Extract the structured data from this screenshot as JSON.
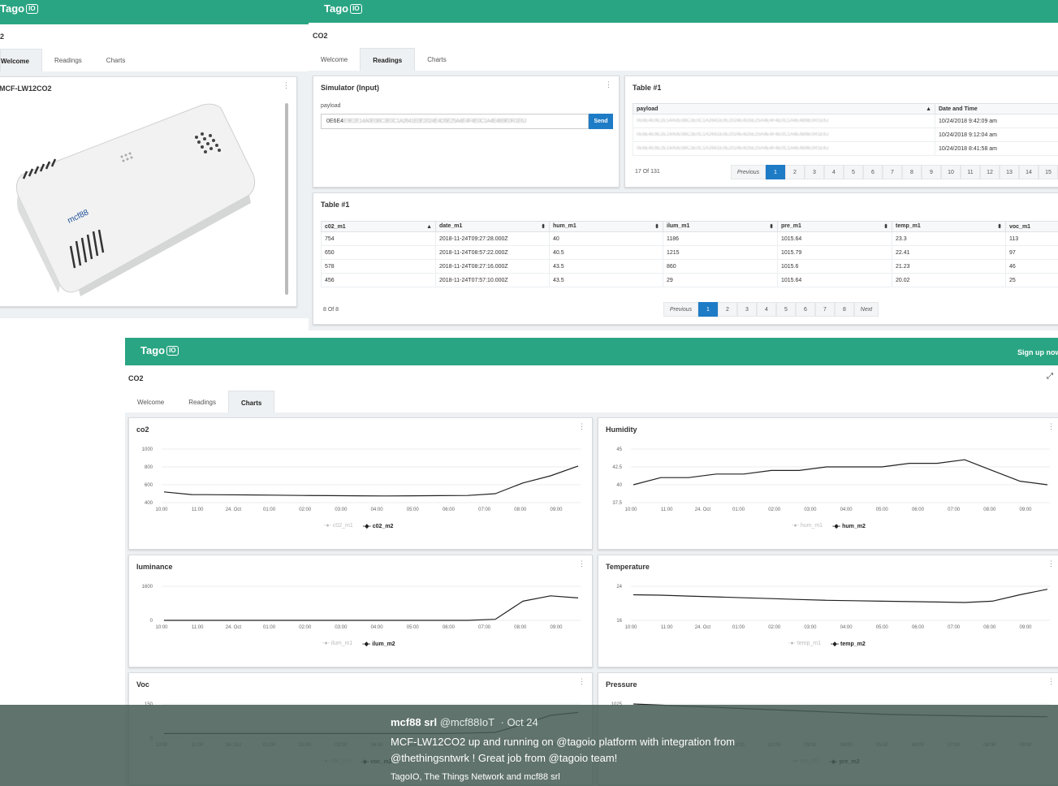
{
  "brand": {
    "name": "Tago",
    "suffix": "IO"
  },
  "dash1": {
    "title": "2",
    "tabs": [
      "Welcome",
      "Readings",
      "Charts"
    ],
    "device_title": "MCF-LW12CO2"
  },
  "dash2": {
    "title": "CO2",
    "tabs": [
      "Welcome",
      "Readings",
      "Charts"
    ],
    "simulator": {
      "title": "Simulator (Input)",
      "label": "payload",
      "value": "0E6E4",
      "send": "Send"
    },
    "table1": {
      "title": "Table #1",
      "headers": [
        "payload",
        "Date and Time"
      ],
      "rows": [
        [
          "0E6E4E9E2E14A0E0BC3E0C1A2641E0E2024E4D5E25A4E4F4E0C1A4E4B9E0R1E6J",
          "10/24/2018 9:42:09 am"
        ],
        [
          "0E6E4E9E2E14A0E0BC3E0C1A2641E0E2024E4D5E25A4E4F4E0C1A4E4B9E0R1E6J",
          "10/24/2018 9:12:04 am"
        ],
        [
          "0E6E4E9E2E14A0E0BC3E0C1A2641E0E2024E4D5E25A4E4F4E0C1A4E4B9E0R1E6J",
          "10/24/2018 8:41:58 am"
        ]
      ],
      "count": "17 Of 131",
      "prev": "Previous",
      "pages": [
        "1",
        "2",
        "3",
        "4",
        "5",
        "6",
        "7",
        "8",
        "9",
        "10",
        "11",
        "12",
        "13",
        "14",
        "15"
      ]
    },
    "table2": {
      "title": "Table #1",
      "headers": [
        "c02_m1",
        "date_m1",
        "hum_m1",
        "ilum_m1",
        "pre_m1",
        "temp_m1",
        "voc_m1"
      ],
      "rows": [
        [
          "754",
          "2018-11-24T09:27:28.000Z",
          "40",
          "1186",
          "1015.64",
          "23.3",
          "113"
        ],
        [
          "650",
          "2018-11-24T08:57:22.000Z",
          "40.5",
          "1215",
          "1015.79",
          "22.41",
          "97"
        ],
        [
          "578",
          "2018-11-24T08:27:16.000Z",
          "43.5",
          "860",
          "1015.6",
          "21.23",
          "46"
        ],
        [
          "456",
          "2018-11-24T07:57:10.000Z",
          "43.5",
          "29",
          "1015.64",
          "20.02",
          "25"
        ]
      ],
      "count": "8 Of 8",
      "prev": "Previous",
      "next": "Next",
      "pages": [
        "1",
        "2",
        "3",
        "4",
        "5",
        "6",
        "7",
        "8"
      ]
    }
  },
  "dash3": {
    "title": "CO2",
    "signup": "Sign up now",
    "tabs": [
      "Welcome",
      "Readings",
      "Charts"
    ],
    "x_ticks": [
      "10:00",
      "11:00",
      "24. Oct",
      "01:00",
      "02:00",
      "03:00",
      "04:00",
      "05:00",
      "06:00",
      "07:00",
      "08:00",
      "09:00"
    ]
  },
  "chart_data": [
    {
      "type": "line",
      "title": "co2",
      "ylim": [
        400,
        1000
      ],
      "yticks": [
        "1000",
        "800",
        "600",
        "400"
      ],
      "series": [
        {
          "name": "c02_m1",
          "values": []
        },
        {
          "name": "c02_m2",
          "values": [
            520,
            490,
            488,
            486,
            484,
            480,
            478,
            476,
            475,
            476,
            478,
            480,
            500,
            620,
            700,
            810
          ]
        }
      ]
    },
    {
      "type": "line",
      "title": "Humidity",
      "ylim": [
        37.5,
        45
      ],
      "yticks": [
        "45",
        "42.5",
        "40",
        "37.5"
      ],
      "series": [
        {
          "name": "hum_m1",
          "values": []
        },
        {
          "name": "hum_m2",
          "values": [
            40.0,
            41.0,
            41.0,
            41.5,
            41.5,
            42.0,
            42.0,
            42.5,
            42.5,
            42.5,
            43.0,
            43.0,
            43.5,
            42.0,
            40.5,
            40.0
          ]
        }
      ]
    },
    {
      "type": "line",
      "title": "luminance",
      "ylim": [
        0,
        1600
      ],
      "yticks": [
        "1600",
        "0"
      ],
      "series": [
        {
          "name": "ilum_m1",
          "values": []
        },
        {
          "name": "ilum_m2",
          "values": [
            0,
            0,
            0,
            0,
            0,
            0,
            0,
            0,
            0,
            0,
            0,
            0,
            50,
            900,
            1150,
            1050
          ]
        }
      ]
    },
    {
      "type": "line",
      "title": "Temperature",
      "ylim": [
        16,
        24
      ],
      "yticks": [
        "24",
        "16"
      ],
      "series": [
        {
          "name": "temp_m1",
          "values": []
        },
        {
          "name": "temp_m2",
          "values": [
            22.0,
            21.9,
            21.7,
            21.5,
            21.3,
            21.1,
            20.9,
            20.7,
            20.6,
            20.5,
            20.4,
            20.3,
            20.2,
            20.5,
            22.0,
            23.3
          ]
        }
      ]
    },
    {
      "type": "line",
      "title": "Voc",
      "ylim": [
        0,
        150
      ],
      "yticks": [
        "150",
        "0"
      ],
      "series": [
        {
          "name": "voc_m1",
          "values": []
        },
        {
          "name": "voc_m2",
          "values": [
            20,
            20,
            20,
            20,
            20,
            20,
            20,
            20,
            20,
            20,
            20,
            22,
            25,
            60,
            100,
            113
          ]
        }
      ]
    },
    {
      "type": "line",
      "title": "Pressure",
      "ylim": [
        1010,
        1025
      ],
      "yticks": [
        "1025"
      ],
      "series": [
        {
          "name": "pre_m1",
          "values": []
        },
        {
          "name": "pre_m2",
          "values": [
            1025,
            1024.5,
            1024,
            1023.5,
            1023,
            1022.5,
            1022,
            1021.5,
            1021,
            1020.5,
            1020.2,
            1020,
            1019.8,
            1019.6,
            1019.5,
            1019.4
          ]
        }
      ]
    }
  ],
  "tweet": {
    "name": "mcf88 srl",
    "handle": "@mcf88IoT",
    "date": "· Oct 24",
    "line1": "MCF-LW12CO2 up and running on @tagoio platform with integration from",
    "line2": "@thethingsntwrk ! Great job from @tagoio team!",
    "footer": "TagoIO, The Things Network and mcf88 srl"
  }
}
